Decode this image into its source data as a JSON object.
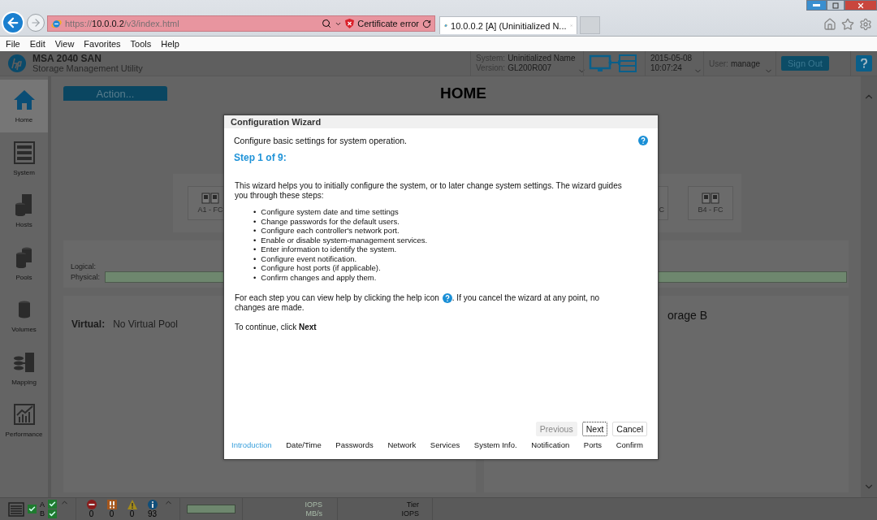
{
  "browser": {
    "address": {
      "scheme": "https://",
      "host": "10.0.0.2",
      "path": "/v3/index.html"
    },
    "certificate": "Certificate error",
    "tab": {
      "title": "10.0.0.2 [A] (Uninitialized N..."
    }
  },
  "menu": [
    "File",
    "Edit",
    "View",
    "Favorites",
    "Tools",
    "Help"
  ],
  "header": {
    "product": "MSA 2040 SAN",
    "subtitle": "Storage Management Utility",
    "system_label": "System:",
    "system_value": "Uninitialized Name",
    "version_label": "Version:",
    "version_value": "GL200R007",
    "date": "2015-05-08",
    "time": "10:07:24",
    "user_label": "User:",
    "user_value": "manage",
    "sign_out": "Sign Out"
  },
  "sidebar": {
    "items": [
      {
        "label": "Home",
        "kind": "home",
        "selected": true
      },
      {
        "label": "System",
        "kind": "system",
        "selected": false
      },
      {
        "label": "Hosts",
        "kind": "hosts",
        "selected": false
      },
      {
        "label": "Pools",
        "kind": "pools",
        "selected": false
      },
      {
        "label": "Volumes",
        "kind": "volumes",
        "selected": false
      },
      {
        "label": "Mapping",
        "kind": "mapping",
        "selected": false
      },
      {
        "label": "Performance",
        "kind": "performance",
        "selected": false
      }
    ]
  },
  "action_button": "Action...",
  "page_title": "HOME",
  "ports": [
    "A1 - FC",
    "C",
    "B4 - FC"
  ],
  "capacity": {
    "logical_label": "Logical:",
    "physical_label": "Physical:"
  },
  "pools": {
    "virtual_label": "Virtual:",
    "virtual_value": "No Virtual Pool",
    "storage_b_title": "orage B"
  },
  "status_bar": {
    "controller_a": "A",
    "controller_b": "B",
    "counts": [
      {
        "kind": "critical",
        "value": "0"
      },
      {
        "kind": "error",
        "value": "0"
      },
      {
        "kind": "warning",
        "value": "0"
      },
      {
        "kind": "info",
        "value": "93"
      }
    ],
    "io_top": "IOPS",
    "io_bottom": "MB/s",
    "tier_top": "Tier",
    "tier_bottom": "IOPS"
  },
  "wizard": {
    "title": "Configuration Wizard",
    "intro": "Configure basic settings for system operation.",
    "step": "Step 1 of 9:",
    "description": "This wizard helps you to initially configure the system, or to later change system settings. The wizard guides you through these steps:",
    "bullet_marker": "•",
    "bullets": [
      "Configure system date and time settings",
      "Change passwords for the default users.",
      "Configure each controller's network port.",
      "Enable or disable system-management services.",
      "Enter information to identify the system.",
      "Configure event notification.",
      "Configure host ports (if applicable).",
      "Confirm changes and apply them."
    ],
    "help_before": "For each step you can view help by clicking the help icon",
    "help_after": ". If you cancel the wizard at any point, no",
    "help_last": "changes are made.",
    "continue": "To continue, click **Next**",
    "buttons": [
      {
        "label": "Previous",
        "disabled": true
      },
      {
        "label": "Next",
        "disabled": false
      },
      {
        "label": "Cancel",
        "disabled": false
      }
    ],
    "steps": [
      {
        "label": "Introduction",
        "selected": true
      },
      {
        "label": "Date/Time",
        "selected": false
      },
      {
        "label": "Passwords",
        "selected": false
      },
      {
        "label": "Network",
        "selected": false
      },
      {
        "label": "Services",
        "selected": false
      },
      {
        "label": "System Info.",
        "selected": false
      },
      {
        "label": "Notification",
        "selected": false
      },
      {
        "label": "Ports",
        "selected": false
      },
      {
        "label": "Confirm",
        "selected": false
      }
    ]
  }
}
